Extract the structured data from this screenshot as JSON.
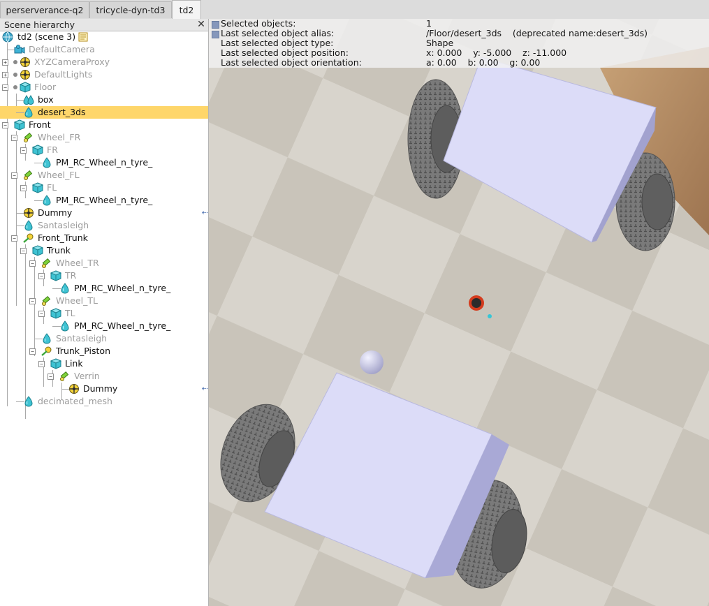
{
  "tabs": [
    {
      "label": "perserverance-q2",
      "active": false
    },
    {
      "label": "tricycle-dyn-td3",
      "active": false
    },
    {
      "label": "td2",
      "active": true
    }
  ],
  "hierarchy": {
    "title": "Scene hierarchy",
    "close_symbol": "✕",
    "root_label": "td2 (scene 3)",
    "items": [
      {
        "label": "DefaultCamera",
        "icon": "camera-icon",
        "greyed": true
      },
      {
        "label": "XYZCameraProxy",
        "icon": "dummy-icon",
        "greyed": true
      },
      {
        "label": "DefaultLights",
        "icon": "dummy-icon",
        "greyed": true
      },
      {
        "label": "Floor",
        "icon": "shape-cube-icon",
        "greyed": true
      },
      {
        "label": "box",
        "icon": "multi-shape-icon",
        "greyed": false
      },
      {
        "label": "desert_3ds",
        "icon": "shape-drop-icon",
        "greyed": false,
        "selected": true
      },
      {
        "label": "Front",
        "icon": "shape-cube-icon",
        "greyed": false
      },
      {
        "label": "Wheel_FR",
        "icon": "joint-icon",
        "greyed": true
      },
      {
        "label": "FR",
        "icon": "shape-cube-icon",
        "greyed": true
      },
      {
        "label": "PM_RC_Wheel_n_tyre_",
        "icon": "shape-drop-icon",
        "greyed": false
      },
      {
        "label": "Wheel_FL",
        "icon": "joint-icon",
        "greyed": true
      },
      {
        "label": "FL",
        "icon": "shape-cube-icon",
        "greyed": true
      },
      {
        "label": "PM_RC_Wheel_n_tyre_",
        "icon": "shape-drop-icon",
        "greyed": false
      },
      {
        "label": "Dummy",
        "icon": "dummy-icon",
        "greyed": false
      },
      {
        "label": "Santasleigh",
        "icon": "shape-drop-icon",
        "greyed": true
      },
      {
        "label": "Front_Trunk",
        "icon": "force-sensor-icon",
        "greyed": false
      },
      {
        "label": "Trunk",
        "icon": "shape-cube-icon",
        "greyed": false
      },
      {
        "label": "Wheel_TR",
        "icon": "joint-icon",
        "greyed": true
      },
      {
        "label": "TR",
        "icon": "shape-cube-icon",
        "greyed": true
      },
      {
        "label": "PM_RC_Wheel_n_tyre_",
        "icon": "shape-drop-icon",
        "greyed": false
      },
      {
        "label": "Wheel_TL",
        "icon": "joint-icon",
        "greyed": true
      },
      {
        "label": "TL",
        "icon": "shape-cube-icon",
        "greyed": true
      },
      {
        "label": "PM_RC_Wheel_n_tyre_",
        "icon": "shape-drop-icon",
        "greyed": false
      },
      {
        "label": "Santasleigh",
        "icon": "shape-drop-icon",
        "greyed": true
      },
      {
        "label": "Trunk_Piston",
        "icon": "force-sensor-icon",
        "greyed": false
      },
      {
        "label": "Link",
        "icon": "shape-cube-icon",
        "greyed": false
      },
      {
        "label": "Verrin",
        "icon": "joint-icon",
        "greyed": true
      },
      {
        "label": "Dummy",
        "icon": "dummy-icon",
        "greyed": false
      },
      {
        "label": "decimated_mesh",
        "icon": "shape-drop-icon",
        "greyed": true
      }
    ],
    "arrow_symbol": "⇠"
  },
  "info": {
    "rows": [
      {
        "label": "Selected objects:",
        "value": "1"
      },
      {
        "label": "Last selected object alias:",
        "value": "/Floor/desert_3ds    (deprecated name:desert_3ds)"
      },
      {
        "label": "Last selected object type:",
        "value": "Shape"
      },
      {
        "label": "Last selected object position:",
        "value": "x: 0.000    y: -5.000    z: -11.000"
      },
      {
        "label": "Last selected object orientation:",
        "value": "a: 0.00    b: 0.00    g: 0.00"
      }
    ]
  },
  "colors": {
    "selection": "#fed66a",
    "box_face": "#dcdcf8",
    "box_side": "#a9a9d6",
    "tyre": "#6f6f6f"
  }
}
